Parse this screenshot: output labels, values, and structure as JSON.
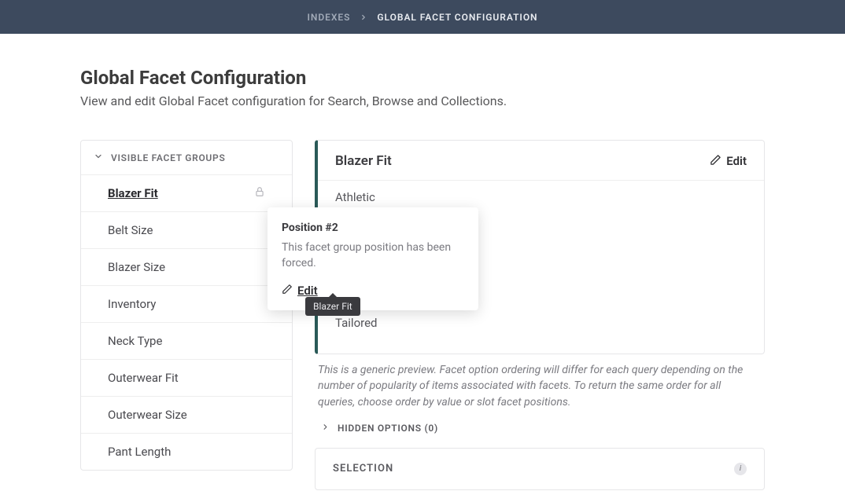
{
  "breadcrumbs": {
    "parent": "INDEXES",
    "current": "GLOBAL FACET CONFIGURATION"
  },
  "page": {
    "title": "Global Facet Configuration",
    "subtitle": "View and edit Global Facet configuration for Search, Browse and Collections."
  },
  "sidebar": {
    "header": "VISIBLE FACET GROUPS",
    "items": [
      {
        "label": "Blazer Fit",
        "active": true,
        "locked": true
      },
      {
        "label": "Belt Size"
      },
      {
        "label": "Blazer Size"
      },
      {
        "label": "Inventory"
      },
      {
        "label": "Neck Type"
      },
      {
        "label": "Outerwear Fit"
      },
      {
        "label": "Outerwear Size"
      },
      {
        "label": "Pant Length"
      }
    ]
  },
  "popover": {
    "title": "Position #2",
    "body": "This facet group position has been forced.",
    "edit_label": "Edit"
  },
  "tooltip": {
    "label": "Blazer Fit"
  },
  "detail": {
    "title": "Blazer Fit",
    "edit_label": "Edit",
    "options": [
      "Athletic",
      "Tailored"
    ],
    "preview_note": "This is a generic preview. Facet option ordering will differ for each query depending on the number of popularity of items associated with facets. To return the same order for all queries, choose order by value or slot facet positions.",
    "hidden_toggle": "HIDDEN OPTIONS (0)"
  },
  "selection": {
    "title": "SELECTION",
    "info_glyph": "i"
  }
}
